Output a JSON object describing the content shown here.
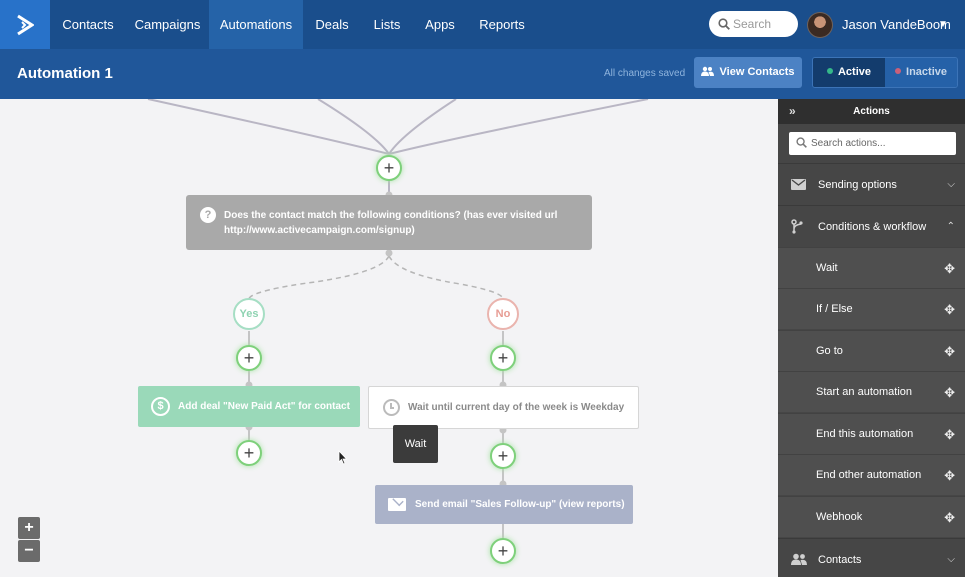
{
  "nav": {
    "items": [
      "Contacts",
      "Campaigns",
      "Automations",
      "Deals",
      "Lists",
      "Apps",
      "Reports"
    ],
    "active": "Automations",
    "search_placeholder": "Search",
    "user_name": "Jason VandeBoom"
  },
  "subheader": {
    "title": "Automation 1",
    "saved_status": "All changes saved",
    "view_contacts": "View Contacts",
    "active_label": "Active",
    "inactive_label": "Inactive"
  },
  "colors": {
    "active_dot": "#35b88a",
    "inactive_dot": "#c9607a"
  },
  "canvas": {
    "condition_text": "Does the contact match the following conditions? (has ever visited url http://www.activecampaign.com/signup)",
    "yes_label": "Yes",
    "no_label": "No",
    "deal_action": "Add deal \"New Paid Act\" for contact",
    "wait_action": "Wait until current day of the week is Weekday",
    "tooltip": "Wait",
    "email_action": "Send email \"Sales Follow-up\" (view reports)",
    "zoom_in": "+",
    "zoom_out": "−"
  },
  "panel": {
    "title": "Actions",
    "search_placeholder": "Search actions...",
    "sections": {
      "sending": "Sending options",
      "conditions": "Conditions & workflow",
      "contacts": "Contacts"
    },
    "workflow_items": [
      "Wait",
      "If / Else",
      "Go to",
      "Start an automation",
      "End this automation",
      "End other automation",
      "Webhook"
    ]
  }
}
